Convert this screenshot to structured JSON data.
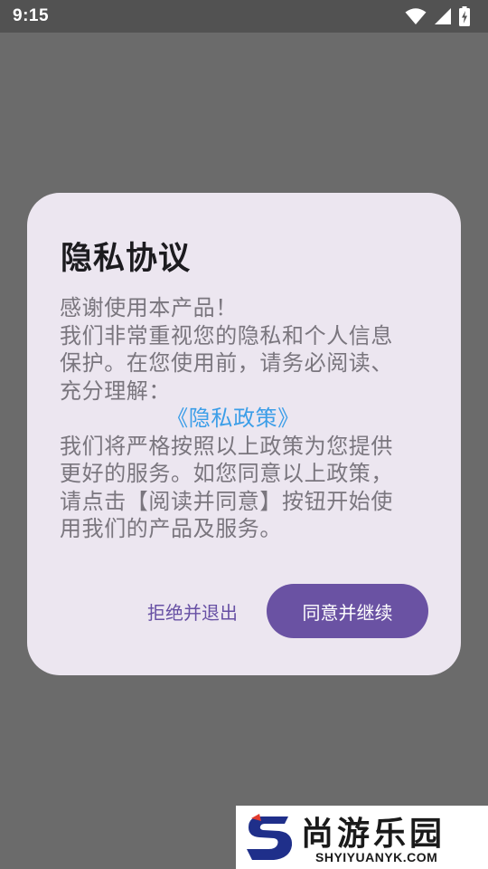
{
  "status_bar": {
    "time": "9:15",
    "icons": [
      "wifi-icon",
      "cellular-signal-icon",
      "battery-charging-icon"
    ]
  },
  "dialog": {
    "title": "隐私协议",
    "body_intro": "感谢使用本产品！",
    "body_para1": "我们非常重视您的隐私和个人信息保护。在您使用前，请务必阅读、充分理解：",
    "policy_link": "《隐私政策》",
    "body_para2": "我们将严格按照以上政策为您提供更好的服务。如您同意以上政策，请点击【阅读并同意】按钮开始使用我们的产品及服务。",
    "decline_label": "拒绝并退出",
    "accept_label": "同意并继续"
  },
  "watermark": {
    "name": "尚游乐园",
    "url": "SHYIYUANYK.COM"
  },
  "colors": {
    "scrim": "#6b6b6b",
    "dialog_bg": "#ece6f0",
    "primary": "#6a52a3",
    "link": "#3c9ee8",
    "body_text": "#7a767e"
  }
}
